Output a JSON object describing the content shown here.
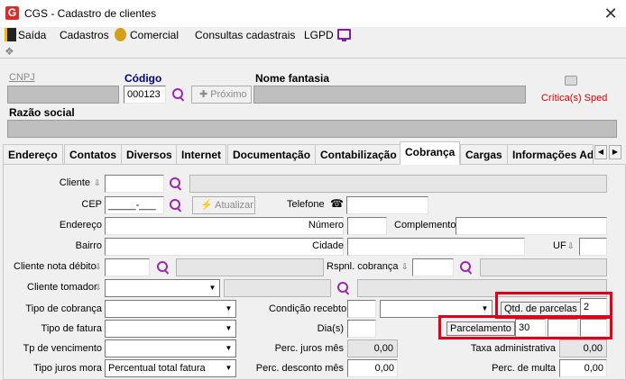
{
  "window": {
    "title": "CGS - Cadastro de clientes",
    "close": "✕"
  },
  "menu": {
    "saida": "Saída",
    "cadastros": "Cadastros",
    "comercial": "Comercial",
    "consultas": "Consultas cadastrais",
    "lgpd": "LGPD"
  },
  "header": {
    "cnpj_label": "CNPJ",
    "codigo_label": "Código",
    "codigo_value": "000123",
    "proximo_label": "Próximo",
    "nome_fantasia_label": "Nome fantasia",
    "critica_label": "Crítica(s) Sped",
    "razao_social_label": "Razão social"
  },
  "tabs": [
    "Endereço",
    "Contatos",
    "Diversos",
    "Internet",
    "Documentação",
    "Contabilização",
    "Cobrança",
    "Cargas",
    "Informações Adi"
  ],
  "tab_arrows": {
    "left": "◀",
    "right": "▶"
  },
  "form": {
    "cliente": "Cliente",
    "cep": "CEP",
    "cep_mask": "_____-___",
    "atualizar": "Atualizar",
    "telefone": "Telefone",
    "endereco": "Endereço",
    "numero": "Número",
    "complemento": "Complemento",
    "bairro": "Bairro",
    "cidade": "Cidade",
    "uf": "UF",
    "cliente_nota_debito": "Cliente nota débito",
    "rspnl_cobranca": "Rspnl. cobrança",
    "cliente_tomador": "Cliente tomador",
    "tipo_cobranca": "Tipo de cobrança",
    "condicao_recebto": "Condição recebto",
    "qtd_parcelas": "Qtd. de parcelas",
    "qtd_parcelas_value": "2",
    "tipo_fatura": "Tipo de fatura",
    "dias": "Dia(s)",
    "parcelamento": "Parcelamento",
    "parcelamento_value": "30",
    "tp_vencimento": "Tp de vencimento",
    "perc_juros_mes": "Perc. juros mês",
    "perc_juros_mes_value": "0,00",
    "taxa_administrativa": "Taxa administrativa",
    "taxa_administrativa_value": "0,00",
    "tipo_juros_mora": "Tipo juros mora",
    "tipo_juros_mora_value": "Percentual total fatura",
    "perc_desconto_mes": "Perc. desconto mês",
    "perc_desconto_mes_value": "0,00",
    "perc_multa": "Perc. de multa",
    "perc_multa_value": "0,00"
  },
  "colors": {
    "accent": "#9c27b0",
    "highlight": "#e0001b",
    "tab_label": "#000080"
  }
}
